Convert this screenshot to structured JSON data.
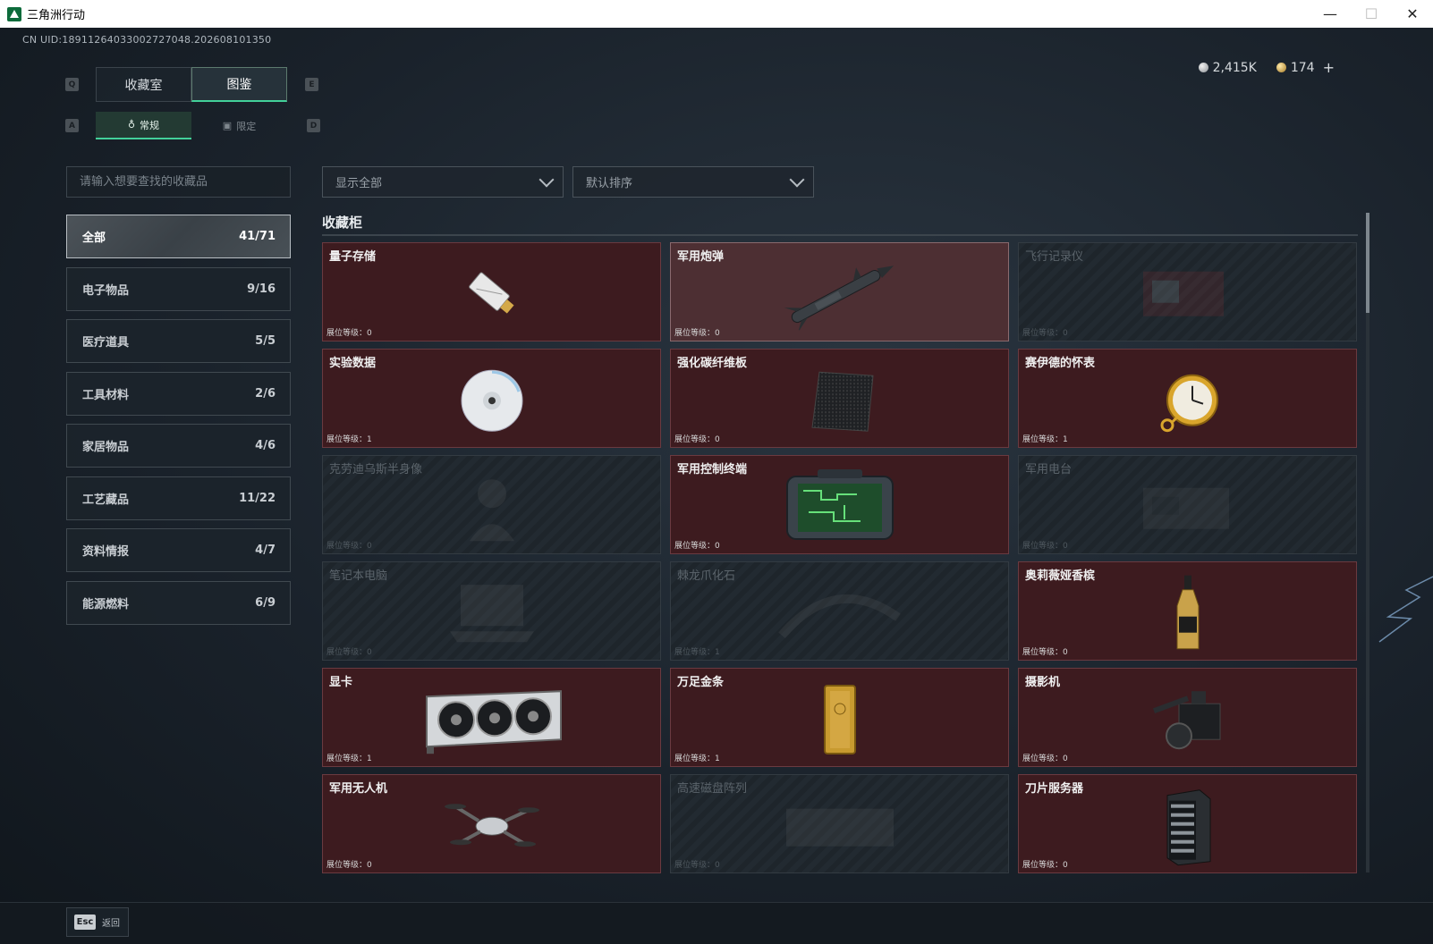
{
  "window": {
    "title": "三角洲行动",
    "minimize": "—",
    "maximize": "☐",
    "close": "✕"
  },
  "uid": "CN UID:18911264033002727048.202608101350",
  "currency": {
    "silver": "2,415K",
    "gold": "174",
    "add": "+"
  },
  "keys": {
    "q": "Q",
    "e": "E",
    "a": "A",
    "d": "D"
  },
  "tabs_main": [
    {
      "label": "收藏室",
      "active": false
    },
    {
      "label": "图鉴",
      "active": true
    }
  ],
  "tabs_sub": [
    {
      "label": "常规",
      "active": true
    },
    {
      "label": "限定",
      "active": false
    }
  ],
  "search": {
    "placeholder": "请输入想要查找的收藏品",
    "value": ""
  },
  "filters": {
    "display": "显示全部",
    "sort": "默认排序"
  },
  "categories": [
    {
      "label": "全部",
      "count": "41/71",
      "active": true
    },
    {
      "label": "电子物品",
      "count": "9/16"
    },
    {
      "label": "医疗道具",
      "count": "5/5"
    },
    {
      "label": "工具材料",
      "count": "2/6"
    },
    {
      "label": "家居物品",
      "count": "4/6"
    },
    {
      "label": "工艺藏品",
      "count": "11/22"
    },
    {
      "label": "资料情报",
      "count": "4/7"
    },
    {
      "label": "能源燃料",
      "count": "6/9"
    }
  ],
  "cabinet": {
    "title": "收藏柜",
    "level_prefix": "展位等级：",
    "items": [
      {
        "name": "量子存储",
        "level": "0",
        "owned": true,
        "icon": "usb-stick-icon"
      },
      {
        "name": "军用炮弹",
        "level": "0",
        "owned": true,
        "highlight": true,
        "icon": "missile-icon"
      },
      {
        "name": "飞行记录仪",
        "level": "0",
        "owned": false,
        "icon": "flight-recorder-icon"
      },
      {
        "name": "实验数据",
        "level": "1",
        "owned": true,
        "icon": "disc-icon"
      },
      {
        "name": "强化碳纤维板",
        "level": "0",
        "owned": true,
        "icon": "carbon-plate-icon"
      },
      {
        "name": "赛伊德的怀表",
        "level": "1",
        "owned": true,
        "icon": "pocket-watch-icon"
      },
      {
        "name": "克劳迪乌斯半身像",
        "level": "0",
        "owned": false,
        "icon": "bust-icon"
      },
      {
        "name": "军用控制终端",
        "level": "0",
        "owned": true,
        "icon": "control-terminal-icon"
      },
      {
        "name": "军用电台",
        "level": "0",
        "owned": false,
        "icon": "radio-icon"
      },
      {
        "name": "笔记本电脑",
        "level": "0",
        "owned": false,
        "icon": "laptop-icon"
      },
      {
        "name": "棘龙爪化石",
        "level": "1",
        "owned": false,
        "icon": "fossil-icon"
      },
      {
        "name": "奥莉薇娅香槟",
        "level": "0",
        "owned": true,
        "icon": "champagne-icon"
      },
      {
        "name": "显卡",
        "level": "1",
        "owned": true,
        "icon": "gpu-icon"
      },
      {
        "name": "万足金条",
        "level": "1",
        "owned": true,
        "icon": "gold-bar-icon"
      },
      {
        "name": "摄影机",
        "level": "0",
        "owned": true,
        "icon": "camera-icon"
      },
      {
        "name": "军用无人机",
        "level": "0",
        "owned": true,
        "icon": "drone-icon"
      },
      {
        "name": "高速磁盘阵列",
        "level": "0",
        "owned": false,
        "icon": "disk-array-icon"
      },
      {
        "name": "刀片服务器",
        "level": "0",
        "owned": true,
        "icon": "server-icon"
      }
    ]
  },
  "footer": {
    "esc_key": "Esc",
    "back_label": "返回"
  },
  "colors": {
    "accent": "#42d19a",
    "owned_card": "#3d1b1f",
    "locked_card": "#222a31"
  }
}
